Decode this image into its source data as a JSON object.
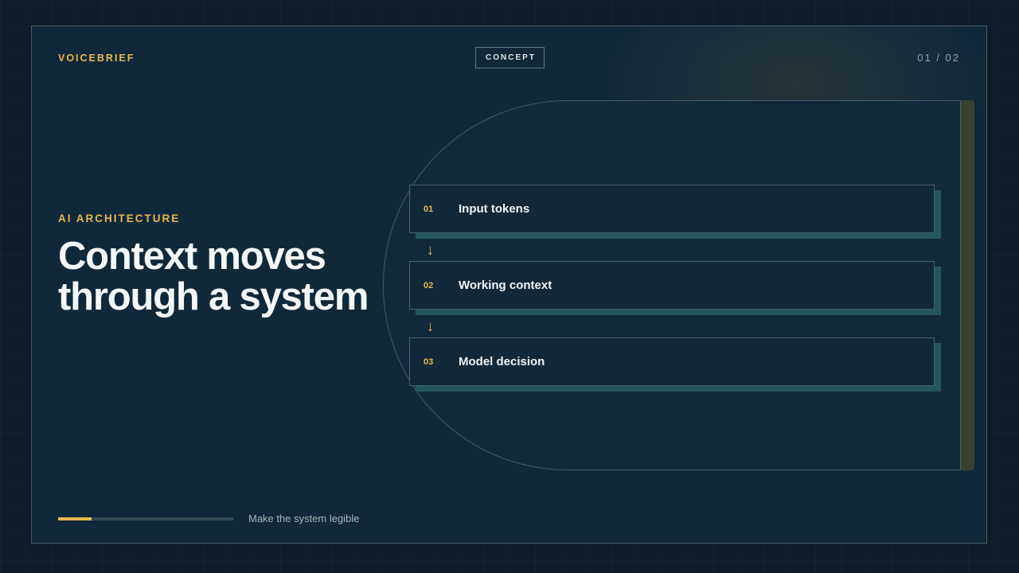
{
  "header": {
    "brand": "VOICEBRIEF",
    "tag": "CONCEPT",
    "page_indicator": "01 / 02"
  },
  "content": {
    "eyebrow": "AI ARCHITECTURE",
    "title": "Context moves through a system"
  },
  "flow": {
    "steps": [
      {
        "number": "01",
        "label": "Input tokens"
      },
      {
        "number": "02",
        "label": "Working context"
      },
      {
        "number": "03",
        "label": "Model decision"
      }
    ],
    "arrow_glyph": "↓"
  },
  "footer": {
    "progress_fraction": 0.19,
    "caption": "Make the system legible"
  },
  "colors": {
    "accent": "#e9b750",
    "background": "#10293a",
    "step_shadow": "#245660"
  }
}
